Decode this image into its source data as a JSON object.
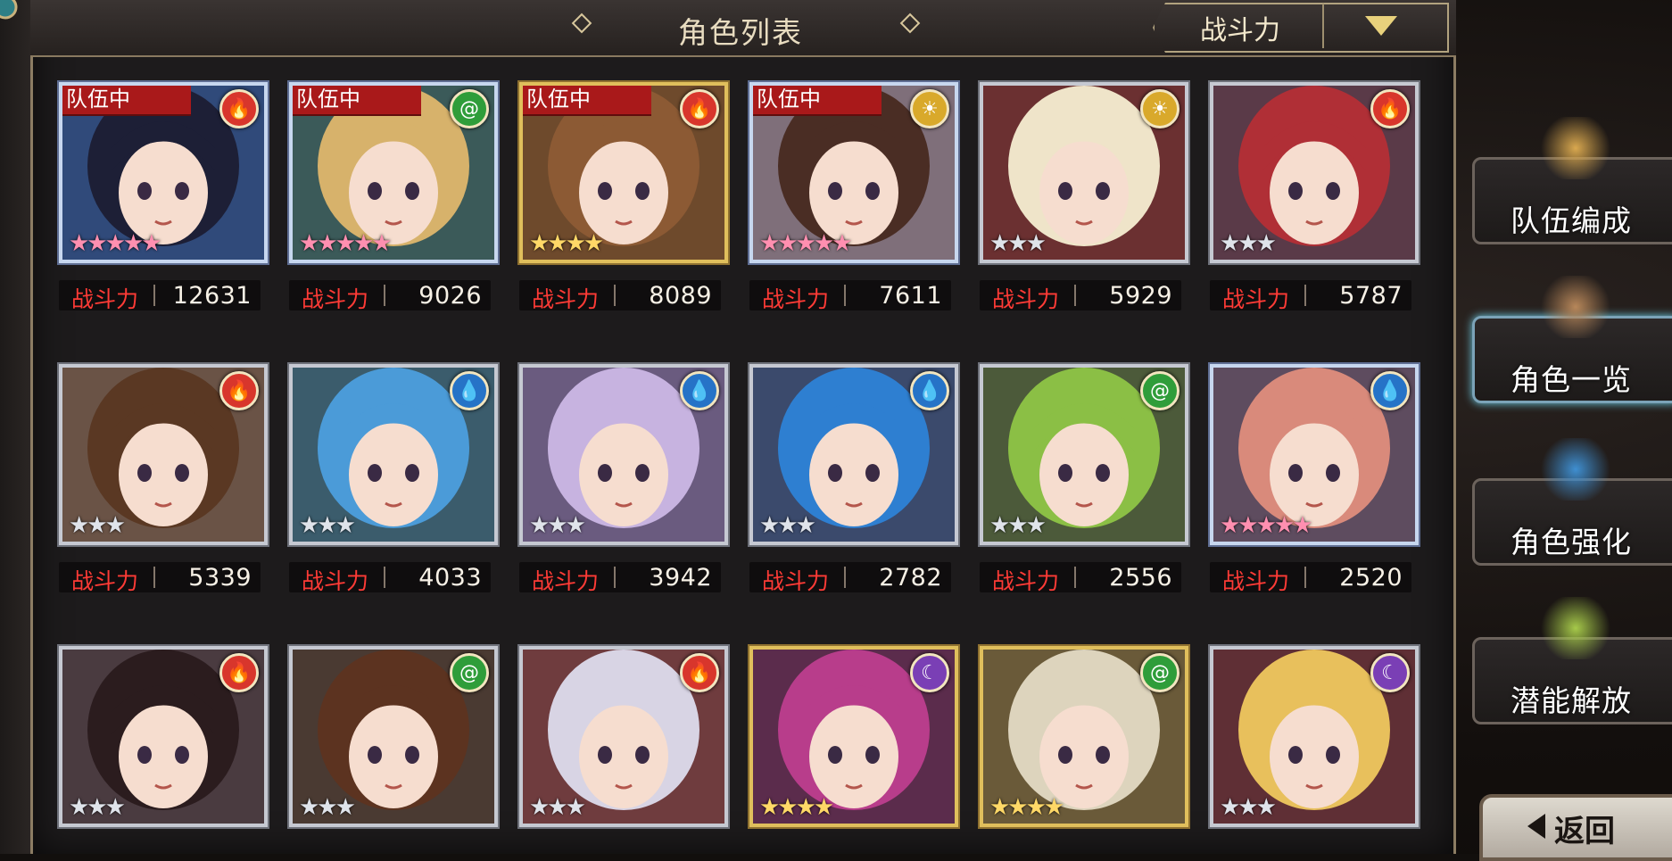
{
  "header": {
    "title": "角色列表",
    "sort": {
      "label": "战斗力"
    }
  },
  "roster": {
    "power_label": "战斗力",
    "badge_in_team": "队伍中",
    "cards": [
      {
        "element": "fire",
        "stars": 5,
        "frame": "blue",
        "in_team": true,
        "power": "12631",
        "hair": "#1d1f36",
        "bg": "#304a7a"
      },
      {
        "element": "wind",
        "stars": 5,
        "frame": "blue",
        "in_team": true,
        "power": "9026",
        "hair": "#d7b26b",
        "bg": "#3b5a59"
      },
      {
        "element": "fire",
        "stars": 4,
        "frame": "gold",
        "in_team": true,
        "power": "8089",
        "hair": "#8c5a34",
        "bg": "#6e4a2c"
      },
      {
        "element": "light",
        "stars": 5,
        "frame": "blue",
        "in_team": true,
        "power": "7611",
        "hair": "#4a2d24",
        "bg": "#7f6f7a"
      },
      {
        "element": "light",
        "stars": 3,
        "frame": "silver",
        "in_team": false,
        "power": "5929",
        "hair": "#efe4c9",
        "bg": "#6b3031"
      },
      {
        "element": "fire",
        "stars": 3,
        "frame": "silver",
        "in_team": false,
        "power": "5787",
        "hair": "#b02f36",
        "bg": "#5a3a48"
      },
      {
        "element": "fire",
        "stars": 3,
        "frame": "silver",
        "in_team": false,
        "power": "5339",
        "hair": "#5a3823",
        "bg": "#6a5346"
      },
      {
        "element": "water",
        "stars": 3,
        "frame": "silver",
        "in_team": false,
        "power": "4033",
        "hair": "#4b9bd8",
        "bg": "#3b5c6c"
      },
      {
        "element": "water",
        "stars": 3,
        "frame": "silver",
        "in_team": false,
        "power": "3942",
        "hair": "#c7b3e0",
        "bg": "#6a5b7f"
      },
      {
        "element": "water",
        "stars": 3,
        "frame": "silver",
        "in_team": false,
        "power": "2782",
        "hair": "#2e7fd1",
        "bg": "#3b4a6c"
      },
      {
        "element": "wind",
        "stars": 3,
        "frame": "silver",
        "in_team": false,
        "power": "2556",
        "hair": "#8bbf45",
        "bg": "#4c5a3a"
      },
      {
        "element": "water",
        "stars": 5,
        "frame": "blue",
        "in_team": false,
        "power": "2520",
        "hair": "#d98a7b",
        "bg": "#5e4c5f"
      },
      {
        "element": "fire",
        "stars": 3,
        "frame": "silver",
        "in_team": false,
        "power": "",
        "hair": "#2b1c1e",
        "bg": "#4a3b40"
      },
      {
        "element": "wind",
        "stars": 3,
        "frame": "silver",
        "in_team": false,
        "power": "",
        "hair": "#5c3320",
        "bg": "#4a3a32"
      },
      {
        "element": "fire",
        "stars": 3,
        "frame": "silver",
        "in_team": false,
        "power": "",
        "hair": "#d8d4e4",
        "bg": "#6f3c3e"
      },
      {
        "element": "dark",
        "stars": 4,
        "frame": "gold",
        "in_team": false,
        "power": "",
        "hair": "#b83d8b",
        "bg": "#5b2c4c"
      },
      {
        "element": "wind",
        "stars": 4,
        "frame": "gold",
        "in_team": false,
        "power": "",
        "hair": "#ddd4bd",
        "bg": "#6a5a39"
      },
      {
        "element": "dark",
        "stars": 3,
        "frame": "silver",
        "in_team": false,
        "power": "",
        "hair": "#e8c05c",
        "bg": "#5f2f35"
      }
    ]
  },
  "sidebar": {
    "buttons": [
      {
        "label": "队伍编成",
        "active": false
      },
      {
        "label": "角色一览",
        "active": true
      },
      {
        "label": "角色强化",
        "active": false
      },
      {
        "label": "潜能解放",
        "active": false
      }
    ],
    "back_label": "返回"
  },
  "element_colors": {
    "fire": "#d8362c",
    "wind": "#2f9d3a",
    "water": "#2673c7",
    "light": "#d9a92b",
    "dark": "#7a3fb5"
  },
  "element_icons": {
    "fire": "flame-icon",
    "wind": "wind-swirl-icon",
    "water": "water-drop-icon",
    "light": "sun-icon",
    "dark": "crescent-moon-icon"
  }
}
